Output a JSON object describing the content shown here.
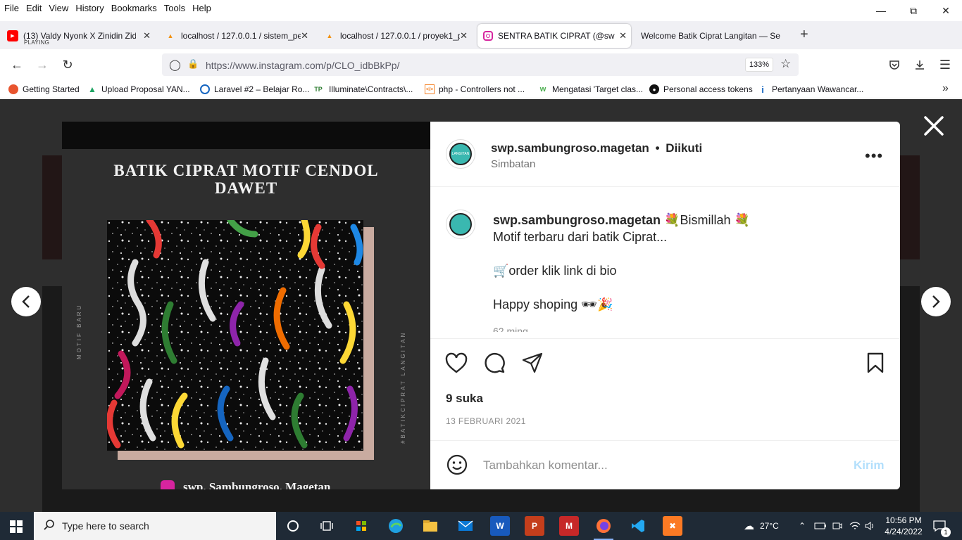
{
  "menu": {
    "items": [
      {
        "label": "File"
      },
      {
        "label": "Edit"
      },
      {
        "label": "View"
      },
      {
        "label": "History"
      },
      {
        "label": "Bookmarks"
      },
      {
        "label": "Tools"
      },
      {
        "label": "Help"
      }
    ]
  },
  "tabs": [
    {
      "title": "(13) Valdy Nyonk X Zinidin Zidan",
      "sub": "PLAYING",
      "icon": "youtube-icon"
    },
    {
      "title": "localhost / 127.0.0.1 / sistem_pe",
      "icon": "phpmyadmin-icon"
    },
    {
      "title": "localhost / 127.0.0.1 / proyek1_p",
      "icon": "phpmyadmin-icon"
    },
    {
      "title": "SENTRA BATIK CIPRAT (@sw",
      "icon": "instagram-icon"
    },
    {
      "title": "Welcome Batik Ciprat Langitan — Se",
      "icon": "none"
    }
  ],
  "nav": {
    "url_host": "https://www.instagram.com",
    "url_path": "/p/CLO_idbBkPp/",
    "zoom": "133%"
  },
  "bookmarks": [
    {
      "label": "Getting Started"
    },
    {
      "label": "Upload Proposal YAN..."
    },
    {
      "label": "Laravel #2 – Belajar Ro..."
    },
    {
      "label": "Illuminate\\Contracts\\..."
    },
    {
      "label": "php - Controllers not ..."
    },
    {
      "label": "Mengatasi 'Target clas..."
    },
    {
      "label": "Personal access tokens"
    },
    {
      "label": "Pertanyaan Wawancar..."
    }
  ],
  "post": {
    "media": {
      "title": "BATIK CIPRAT MOTIF CENDOL DAWET",
      "vertical_left": "MOTIF BARU",
      "vertical_right": "#BATIKCIPRAT LANGITAN",
      "handle": "swp. Sambungroso. Magetan"
    },
    "header": {
      "username": "swp.sambungroso.magetan",
      "separator": "•",
      "follow_state": "Diikuti",
      "location": "Simbatan",
      "avatar_text": "LANGITAN"
    },
    "caption": {
      "username": "swp.sambungroso.magetan",
      "line1": "💐Bismillah 💐",
      "line2": "Motif terbaru dari batik Ciprat...",
      "line3": "🛒order klik link di bio",
      "line4": "Happy shoping 🕶🎉",
      "time": "62 ming"
    },
    "likes": "9 suka",
    "date": "13 FEBRUARI 2021",
    "comment_placeholder": "Tambahkan komentar...",
    "send_label": "Kirim"
  },
  "taskbar": {
    "search_placeholder": "Type here to search",
    "weather": "27°C",
    "time": "10:56 PM",
    "date": "4/24/2022",
    "notifications": "1"
  },
  "colors": {
    "accent_blue": "#0095f6",
    "send_disabled": "#b2dffc",
    "taskbar": "#1f2a36"
  }
}
